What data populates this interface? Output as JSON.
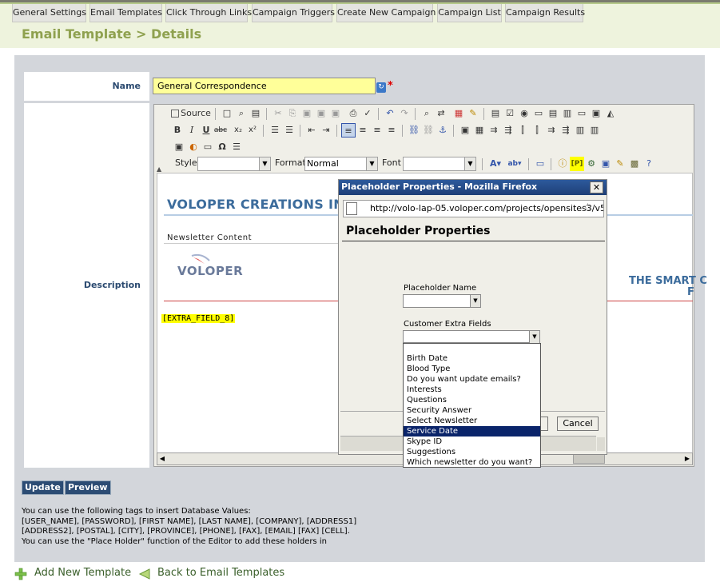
{
  "nav": {
    "tabs": [
      {
        "label": "General Settings"
      },
      {
        "label": "Email Templates"
      },
      {
        "label": "Click Through Links"
      },
      {
        "label": "Campaign Triggers"
      },
      {
        "label": "Create New Campaign"
      },
      {
        "label": "Campaign List"
      },
      {
        "label": "Campaign Results"
      }
    ]
  },
  "page": {
    "title": "Email Template > Details"
  },
  "form": {
    "name_label": "Name",
    "name_value": "General Correspondence",
    "required_mark": "*",
    "description_label": "Description"
  },
  "editor": {
    "toolbar": {
      "source_label": "Source",
      "style_label": "Style",
      "style_value": "",
      "format_label": "Format",
      "format_value": "Normal",
      "font_label": "Font",
      "font_value": ""
    },
    "content": {
      "company_name": "VOLOPER CREATIONS INC",
      "newsletter_label": "Newsletter Content",
      "logo_text": "VOLOPER",
      "extra_field": "[EXTRA_FIELD_8]",
      "right_text": "THE SMART C",
      "right_text_2": "F"
    }
  },
  "popup": {
    "window_title": "Placeholder Properties - Mozilla Firefox",
    "url": "http://volo-lap-05.voloper.com/projects/opensites3/v5",
    "heading": "Placeholder Properties",
    "placeholder_name_label": "Placeholder Name",
    "placeholder_name_value": "",
    "customer_extra_fields_label": "Customer Extra Fields",
    "customer_extra_fields_value": "",
    "cancel_label": "Cancel",
    "dropdown_options": [
      "",
      "Birth Date",
      "Blood Type",
      "Do you want update emails?",
      "Interests",
      "Questions",
      "Security Answer",
      "Select Newsletter",
      "Service Date",
      "Skype ID",
      "Suggestions",
      "Which newsletter do you want?"
    ],
    "selected_option": "Service Date"
  },
  "actions": {
    "update_label": "Update",
    "preview_label": "Preview"
  },
  "help": {
    "line1": "You can use the following tags to insert Database Values:",
    "line2": "[USER_NAME], [PASSWORD], [FIRST NAME], [LAST NAME], [COMPANY], [ADDRESS1]",
    "line3": "[ADDRESS2], [POSTAL], [CITY], [PROVINCE], [PHONE], [FAX], [EMAIL] [FAX] [CELL].",
    "line4": "You can use the \"Place Holder\" function of the Editor to add these holders in"
  },
  "footer": {
    "add_label": "Add New Template",
    "back_label": "Back to Email Templates"
  },
  "colors": {
    "title_green": "#8fa14f",
    "label_blue": "#2b4a70",
    "button_navy": "#2c4c74",
    "selection_navy": "#0a246a",
    "name_field_yellow": "#ffff99"
  }
}
